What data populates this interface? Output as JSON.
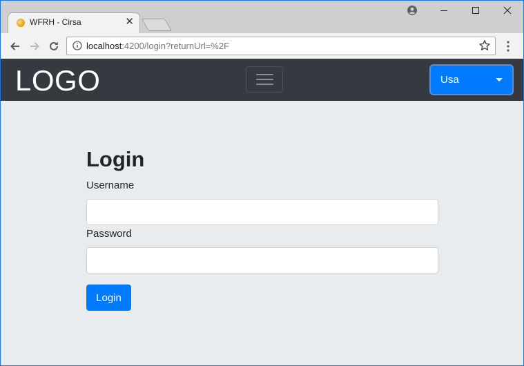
{
  "browser": {
    "tab": {
      "title": "WFRH - Cirsa",
      "favicon": "coin-favicon-icon",
      "close_icon": "close-icon"
    },
    "new_tab_icon": "new-tab-icon",
    "window_controls": [
      "minimize-icon",
      "maximize-icon",
      "close-icon"
    ],
    "profile_icon": "profile-icon",
    "nav": {
      "back_icon": "back-arrow-icon",
      "forward_icon": "forward-arrow-icon",
      "reload_icon": "reload-icon"
    },
    "address_bar": {
      "host": "localhost",
      "path": ":4200/login?returnUrl=%2F",
      "info_icon": "info-icon",
      "bookmark_icon": "star-icon"
    },
    "menu_icon": "more-vertical-icon"
  },
  "navbar": {
    "logo": "LOGO",
    "toggler_icon": "hamburger-menu-icon",
    "country_select": {
      "selected": "Usa",
      "caret_icon": "caret-down-icon"
    }
  },
  "login_form": {
    "title": "Login",
    "username_label": "Username",
    "username_value": "",
    "password_label": "Password",
    "password_value": "",
    "submit_label": "Login"
  },
  "colors": {
    "navbar_bg": "#343a40",
    "primary": "#007bff",
    "page_bg": "#e9ecef"
  }
}
